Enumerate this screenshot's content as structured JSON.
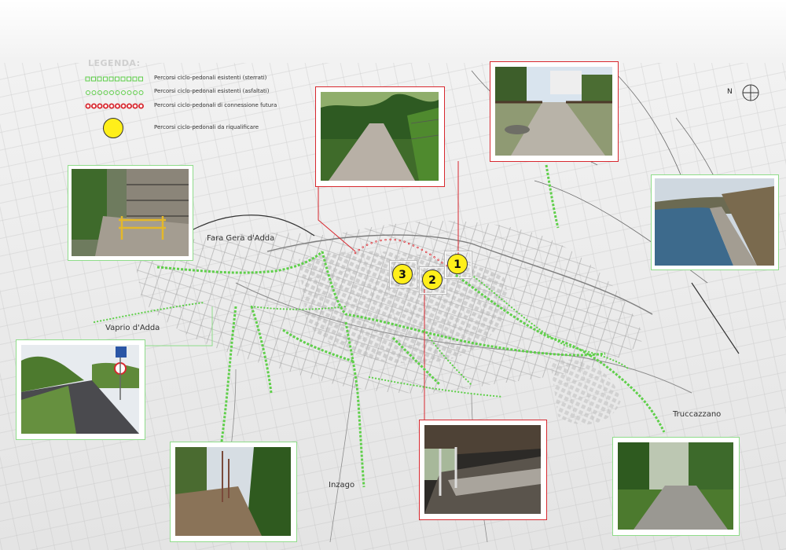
{
  "legend": {
    "title": "LEGENDA:",
    "items": [
      {
        "label": "Percorsi ciclo-pedonali esistenti (sterrati)",
        "symbol": "green-square-dots",
        "color": "#5fcf4a"
      },
      {
        "label": "Percorsi ciclo-pedonali esistenti (asfaltati)",
        "symbol": "green-circle-dots",
        "color": "#5fcf4a"
      },
      {
        "label": "Percorsi ciclo-pedonali di connessione futura",
        "symbol": "red-circle-dots",
        "color": "#d8282f"
      },
      {
        "label": "Percorsi ciclo-pedonali da riqualificare",
        "symbol": "yellow-circle",
        "color": "#ffef1a"
      }
    ]
  },
  "places": {
    "fara": "Fara Gera d'Adda",
    "vaprio": "Vaprio d'Adda",
    "inzago": "Inzago",
    "truccazzano": "Truccazzano"
  },
  "markers": [
    "1",
    "2",
    "3"
  ],
  "north_symbol": "N",
  "colors": {
    "route_green": "#5fcf4a",
    "route_red": "#d8282f",
    "marker_yellow": "#ffef1a",
    "frame_red": "#d8282f",
    "frame_green": "#8fdc8a"
  },
  "photos": [
    {
      "subject": "gravel-path-trees",
      "frame": "red"
    },
    {
      "subject": "garden-path-buildings",
      "frame": "red"
    },
    {
      "subject": "path-yellow-barrier",
      "frame": "green"
    },
    {
      "subject": "canal-towpath",
      "frame": "green"
    },
    {
      "subject": "road-traffic-signs",
      "frame": "green"
    },
    {
      "subject": "dirt-track-poles",
      "frame": "green"
    },
    {
      "subject": "covered-wash-house",
      "frame": "red"
    },
    {
      "subject": "park-paved-path",
      "frame": "green"
    }
  ]
}
